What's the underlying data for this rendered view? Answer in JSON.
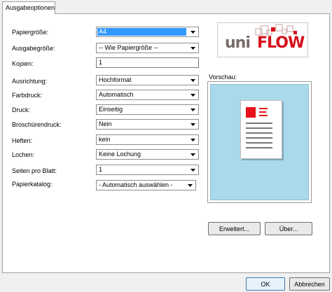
{
  "tab": {
    "label": "Ausgabeoptionen"
  },
  "form": {
    "rows": [
      {
        "label": "Papiergröße:",
        "value": "A4",
        "type": "select",
        "selected": true
      },
      {
        "label": "Ausgabegröße:",
        "value": "-- Wie Papiergröße --",
        "type": "select"
      },
      {
        "label": "Kopien:",
        "value": "1",
        "type": "text"
      },
      {
        "label": "Ausrichtung:",
        "value": "Hochformat",
        "type": "select"
      },
      {
        "label": "Farbdruck:",
        "value": "Automatisch",
        "type": "select"
      },
      {
        "label": "Druck:",
        "value": "Einseitig",
        "type": "select"
      },
      {
        "label": "Broschürendruck:",
        "value": "Nein",
        "type": "select"
      },
      {
        "label": "Heften:",
        "value": "kein",
        "type": "select"
      },
      {
        "label": "Lochen:",
        "value": "Keine Lochung",
        "type": "select"
      },
      {
        "label": "Seiten pro Blatt:",
        "value": "1",
        "type": "select"
      },
      {
        "label": "Papierkatalog:",
        "value": "- Automatisch auswählen -",
        "type": "select"
      }
    ]
  },
  "logo": {
    "part1": "uni",
    "part2": "FLOW",
    "brand_color": "#d6101a",
    "gray_color": "#7a6b6b"
  },
  "preview": {
    "label": "Vorschau:"
  },
  "buttons": {
    "advanced": "Erweitert...",
    "about": "Über...",
    "ok": "OK",
    "cancel": "Abbrechen"
  }
}
